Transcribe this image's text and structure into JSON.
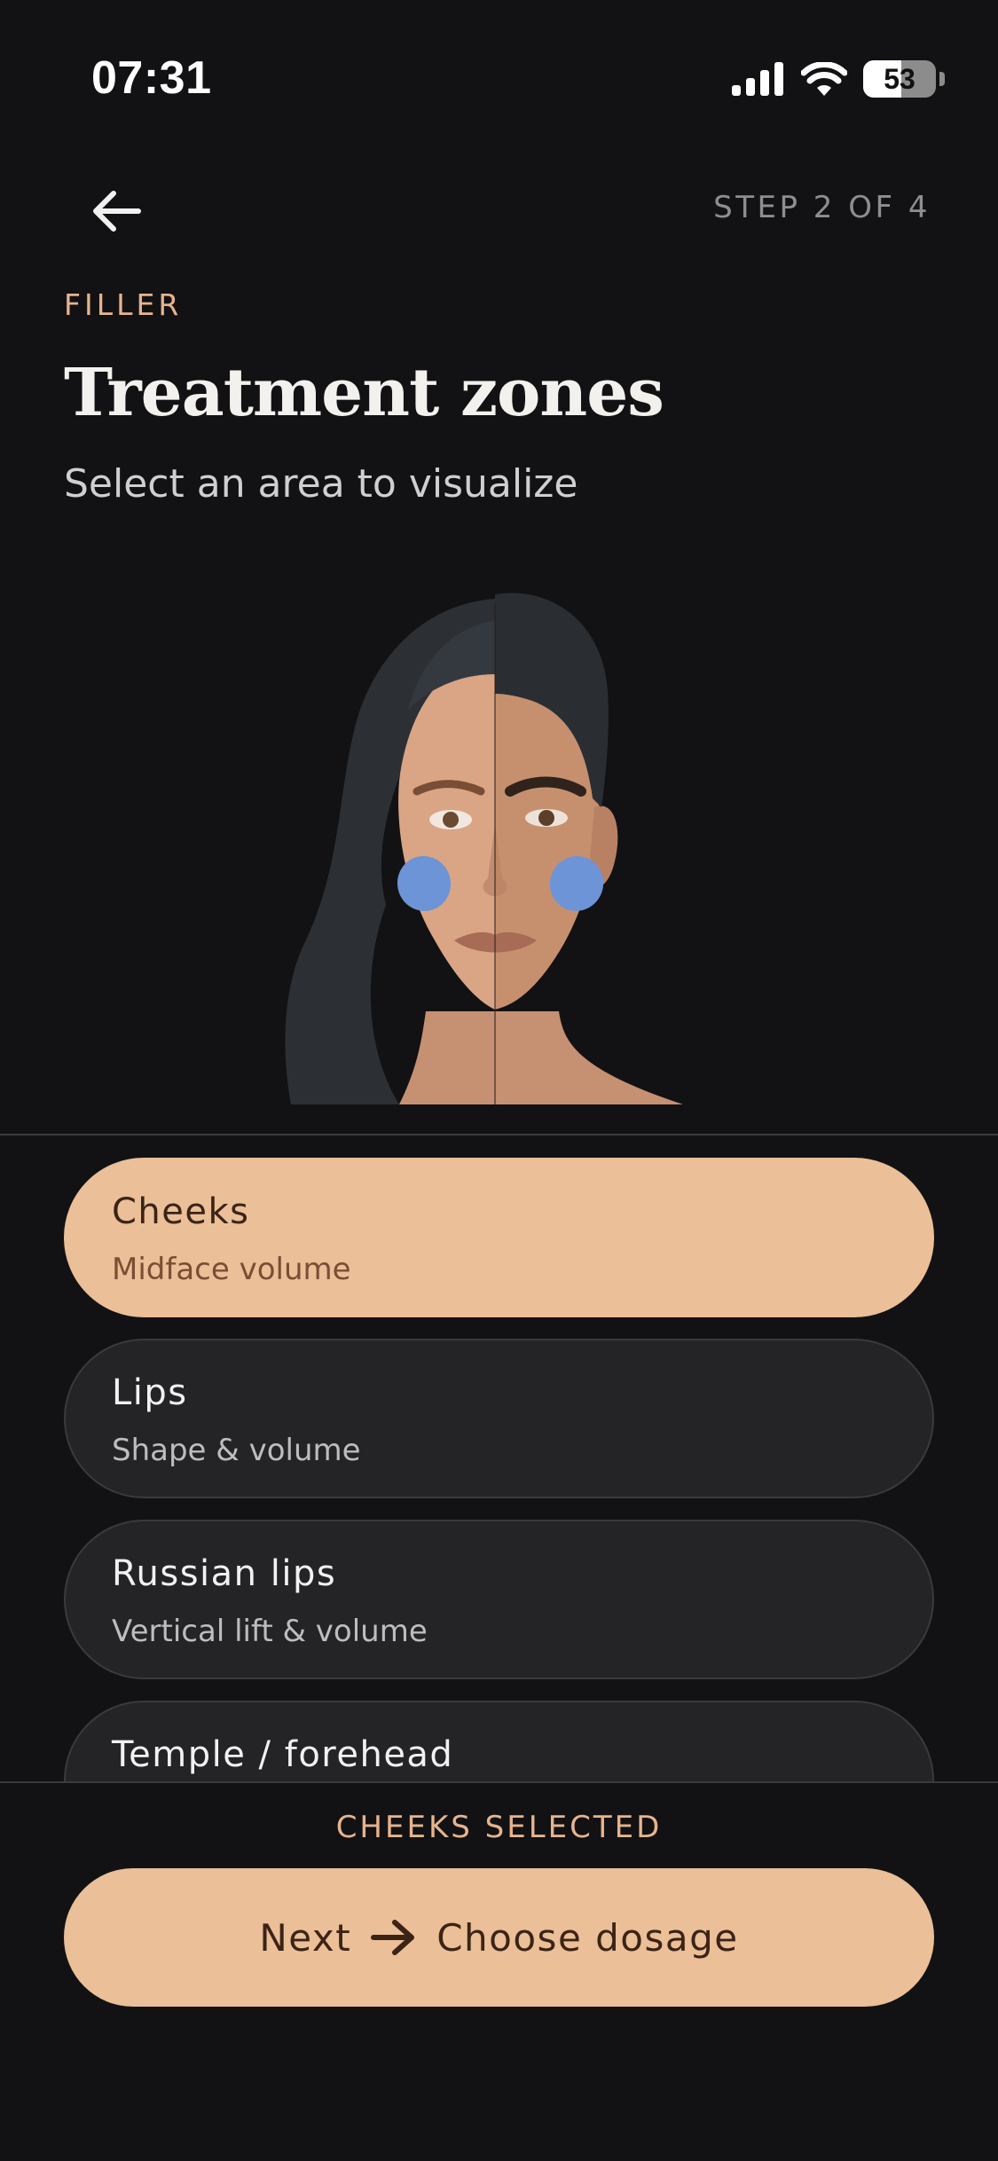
{
  "status_bar": {
    "time": "07:31",
    "battery_level": "53",
    "battery_fraction": 0.53
  },
  "header": {
    "step": "STEP 2 OF 4",
    "eyebrow": "FILLER",
    "title": "Treatment zones",
    "subtitle": "Select an area to visualize"
  },
  "face_illustration": {
    "highlight_color": "#6D94D6",
    "highlighted_zone": "cheeks"
  },
  "zones": [
    {
      "name": "Cheeks",
      "description": "Midface volume",
      "selected": true
    },
    {
      "name": "Lips",
      "description": "Shape & volume",
      "selected": false
    },
    {
      "name": "Russian lips",
      "description": "Vertical lift & volume",
      "selected": false
    },
    {
      "name": "Temple / forehead",
      "description": "",
      "selected": false
    }
  ],
  "footer": {
    "selection_status": "CHEEKS SELECTED",
    "next_label": "Next",
    "next_destination": "Choose dosage"
  },
  "colors": {
    "accent": "#EBBF97",
    "accent_text": "#E6B48D",
    "background": "#121214",
    "card": "#242427"
  }
}
